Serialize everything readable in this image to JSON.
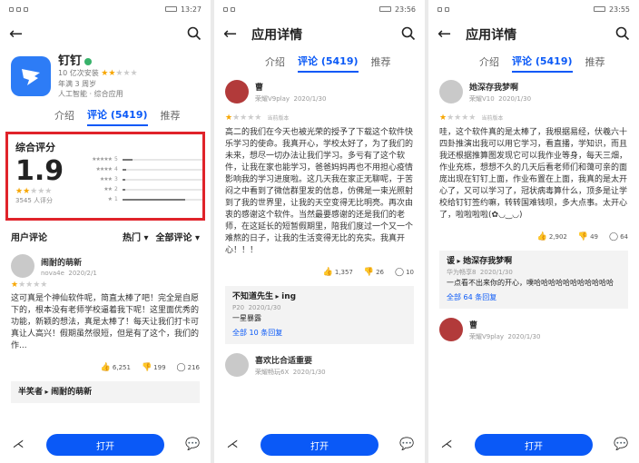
{
  "colors": {
    "accent": "#0a59f7",
    "highlight_box": "#e0232a",
    "star": "#f7a600"
  },
  "icons": {
    "back": "arrow-left-icon",
    "search": "search-icon",
    "share": "share-icon",
    "comment": "comment-icon",
    "like": "thumbs-up-icon",
    "dislike": "thumbs-down-icon"
  },
  "p1": {
    "time": "13:27",
    "app": {
      "name": "钉钉",
      "installs": "10 亿次安装",
      "age": "年满 3 周岁",
      "tags": "人工智能 · 综合应用"
    },
    "tabs": [
      "介绍",
      "评论 (5419)",
      "推荐"
    ],
    "rating": {
      "title": "综合评分",
      "score": "1.9",
      "count": "3545 人评分",
      "dist_labels": [
        "5",
        "4",
        "3",
        "2",
        "1"
      ],
      "dist_fractions": [
        0.12,
        0.04,
        0.03,
        0.03,
        0.78
      ]
    },
    "user_reviews": {
      "label": "用户评论",
      "sort": "热门",
      "filter": "全部评论"
    },
    "review": {
      "name": "闹耐的萌新",
      "device": "nova4e",
      "date": "2020/2/1",
      "text": "这可真是个神仙软件呢，简直太棒了吧！完全是自愿下的，根本没有老师学校逼着我下呢！这里面优秀的功能，新颖的想法，真是太棒了！每天让我们打卡可真让人高兴！假期虽然很短，但是有了这个，我们的作...",
      "likes": "6,251",
      "dislikes": "199",
      "comments": "216"
    },
    "reply": {
      "name": "半笑者",
      "to": "闹耐的萌新"
    },
    "open": "打开"
  },
  "p2": {
    "time": "23:56",
    "title": "应用详情",
    "tabs": [
      "介绍",
      "评论 (5419)",
      "推荐"
    ],
    "review": {
      "name": "曹",
      "device": "荣耀V9play",
      "date": "2020/1/30",
      "version": "当前版本",
      "text": "高二的我们在今天也被光荣的授予了下载这个软件快乐学习的使命。我真开心，学校太好了，为了我们的未来，想尽一切办法让我们学习。多亏有了这个软件，让我在家也能学习，爸爸妈妈再也不用担心疫情影响我的学习进度啦。这几天我在家正无聊呢，于苦闷之中看到了微信群里发的信息，仿佛是一束光照射到了我的世界里，让我的天空变得无比明亮。再次由衷的感谢这个软件。当然最要感谢的还是我们的老师，在这延长的短暂假期里，陪我们度过一个又一个难熬的日子，让我的生活变得无比的充实。我真开心！！！",
      "likes": "1,357",
      "dislikes": "26",
      "comments": "10"
    },
    "reply": {
      "name": "不知道先生",
      "to": "ing",
      "device": "P20",
      "date": "2020/1/30",
      "content": "一星暴露",
      "more": "全部 10 条回复"
    },
    "next": {
      "name": "喜欢比合适重要",
      "device": "荣耀畅玩6X",
      "date": "2020/1/30"
    },
    "open": "打开"
  },
  "p3": {
    "time": "23:55",
    "title": "应用详情",
    "tabs": [
      "介绍",
      "评论 (5419)",
      "推荐"
    ],
    "review": {
      "name": "她深存我梦啊",
      "device": "荣耀V10",
      "date": "2020/1/30",
      "version": "当前版本",
      "text": "哇，这个软件真的是太棒了，我根据易经，伏羲六十四卦推演出我可以用它学习，看直播，学知识，而且我还根据推算图发现它可以我作业等身，每天三畑，作业充栋，想想不久的几天后看老师们和蔼可亲的面庞出现在钉钉上面，作业布置在上面，我真的是太开心了，又可以学习了，冠状病毒算什么，顶多是让学校给钉钉签约嘛，转转国难钱呗，多大点事。太开心了，啦啦啦啦(✿◡‿◡)",
      "likes": "2,902",
      "dislikes": "49",
      "comments": "64"
    },
    "reply": {
      "name": "谖",
      "to": "她深存我梦啊",
      "device": "华为畅享8",
      "date": "2020/1/30",
      "content": "一点看不出来你的开心，噗哈哈哈哈哈哈哈哈哈哈哈",
      "more": "全部 64 条回复"
    },
    "next": {
      "name": "曹",
      "device": "荣耀V9play",
      "date": "2020/1/30"
    },
    "open": "打开"
  }
}
